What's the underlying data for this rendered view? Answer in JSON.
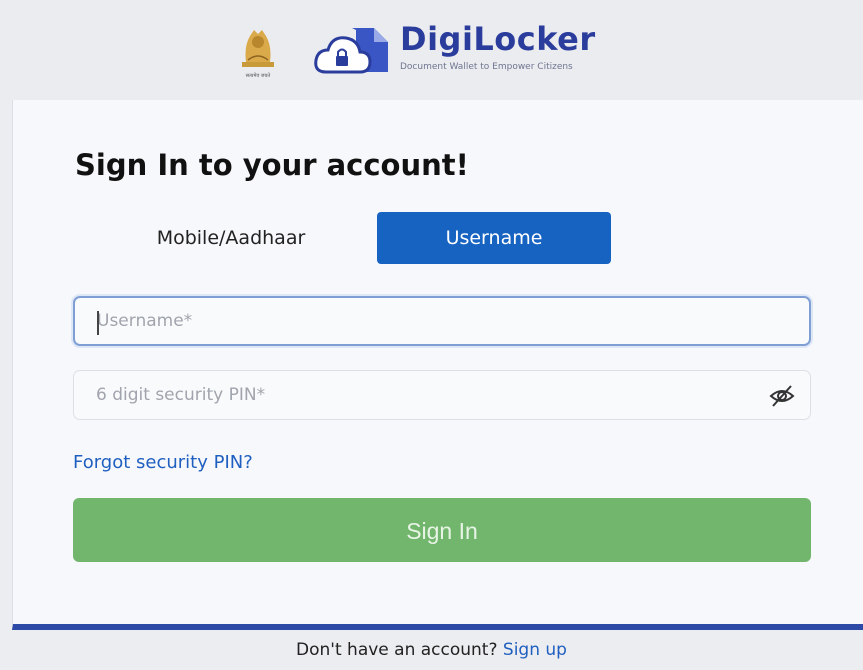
{
  "header": {
    "emblem_icon": "state-emblem-icon",
    "emblem_caption": "सत्यमेव जयते",
    "cloud_icon": "cloud-lock-icon",
    "brand_name": "DigiLocker",
    "tagline": "Document Wallet to Empower Citizens"
  },
  "form": {
    "title": "Sign In to your account!",
    "tabs": [
      {
        "label": "Mobile/Aadhaar",
        "active": false
      },
      {
        "label": "Username",
        "active": true
      }
    ],
    "username": {
      "placeholder": "Username*",
      "value": ""
    },
    "pin": {
      "placeholder": "6 digit security PIN*",
      "value": "",
      "toggle_icon": "eye-slash-icon"
    },
    "forgot_link": "Forgot security PIN?",
    "submit_label": "Sign In"
  },
  "footer": {
    "prompt": "Don't have an account?",
    "link": "Sign up"
  },
  "colors": {
    "brand": "#2b3d9c",
    "active_tab": "#1763c2",
    "link": "#1f5fc0",
    "submit": "#71b66c",
    "card_border": "#2c4aa6"
  }
}
